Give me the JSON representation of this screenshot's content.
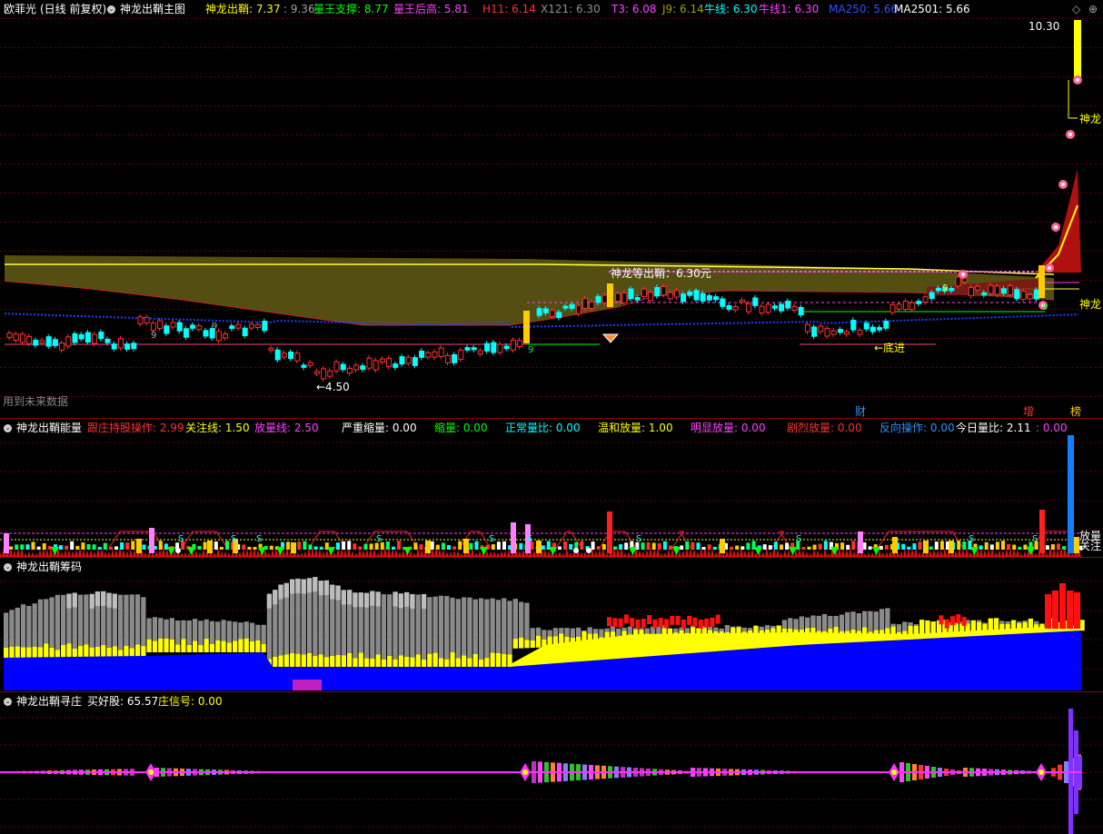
{
  "main": {
    "stock_name": "欧菲光",
    "period": "(日线 前复权)",
    "indicator": "神龙出鞘主图",
    "legend": [
      {
        "text": "神龙出鞘: 7.37",
        "color": "#ffff00"
      },
      {
        "text": ": 9.36",
        "color": "#a0a0a0"
      },
      {
        "text": "量王支撑: 8.77",
        "color": "#00ff00"
      },
      {
        "text": "量王后高: 5.81",
        "color": "#ff40ff"
      },
      {
        "text": "H11: 6.14",
        "color": "#ff3030"
      },
      {
        "text": "X121: 6.30",
        "color": "#909090"
      },
      {
        "text": "T3: 6.08",
        "color": "#ff40ff"
      },
      {
        "text": "J9: 6.14",
        "color": "#a0a000"
      },
      {
        "text": "牛线: 6.30",
        "color": "#00ffff"
      },
      {
        "text": "牛线1: 6.30",
        "color": "#ff40ff"
      },
      {
        "text": "MA250: 5.66",
        "color": "#3050ff"
      },
      {
        "text": "MA2501: 5.66",
        "color": "#ffffff"
      }
    ],
    "price_high": "10.30",
    "price_low": "←4.50",
    "label_shenlong_top": "神龙",
    "label_shenlong_right": "神龙",
    "label_dengchuqiao": "神龙等出鞘：6.30元",
    "label_dijin": "←底进",
    "label_future": "用到未来数据",
    "label_cai": "财",
    "label_zeng": "增",
    "label_jiang": "榜",
    "nine_labels": [
      "9",
      "9",
      "9",
      "9",
      "9"
    ]
  },
  "energy": {
    "title": "神龙出鞘能量",
    "legend": [
      {
        "text": "跟庄持股操作: 2.99",
        "color": "#ff3030"
      },
      {
        "text": "关注线: 1.50",
        "color": "#ffff00"
      },
      {
        "text": "放量线: 2.50",
        "color": "#ff40ff"
      },
      {
        "text": "严重缩量: 0.00",
        "color": "#ffffff"
      },
      {
        "text": "缩量: 0.00",
        "color": "#00ff00"
      },
      {
        "text": "正常量比: 0.00",
        "color": "#00ffff"
      },
      {
        "text": "温和放量: 1.00",
        "color": "#ffff00"
      },
      {
        "text": "明显放量: 0.00",
        "color": "#ff40ff"
      },
      {
        "text": "剧烈放量: 0.00",
        "color": "#ff3030"
      },
      {
        "text": "反向操作: 0.00",
        "color": "#3090ff"
      },
      {
        "text": "今日量比: 2.11",
        "color": "#ffffff"
      },
      {
        "text": ": 0.00",
        "color": "#ff40ff"
      }
    ],
    "right_label_1": "放量",
    "right_label_2": "关注",
    "s_label": "S"
  },
  "chips": {
    "title": "神龙出鞘筹码"
  },
  "seek": {
    "title": "神龙出鞘寻庄",
    "legend": [
      {
        "text": "买好股: 65.57",
        "color": "#ffffff"
      },
      {
        "text": "庄信号: 0.00",
        "color": "#ffff00"
      }
    ]
  },
  "colors": {
    "up": "#ff3030",
    "down": "#00ffff",
    "grid": "#8a0000",
    "ma_blue": "#2040ff",
    "gold_band": "#5a5214"
  }
}
